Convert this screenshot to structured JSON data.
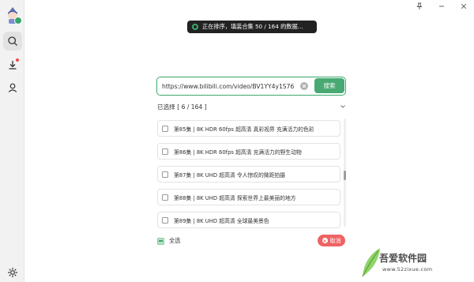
{
  "toast": {
    "text": "正在排序，填装合集 50 / 164 的数据..."
  },
  "search": {
    "url_value": "https://www.bilibili.com/video/BV1YY4y1S76",
    "button_label": "搜索"
  },
  "selection": {
    "header": "已选择 [ 6 / 164 ]"
  },
  "episodes": [
    "第85集 | 8K HDR 60fps 超高清 真彩视界 充满活力的色彩",
    "第86集 | 8K HDR 60fps 超高清 充满活力的野生动物",
    "第87集 | 8K UHD 超高清 令人惊叹的微距拍摄",
    "第88集 | 8K UHD 超高清 探索世界上最美丽的地方",
    "第89集 | 8K UHD 超高清 全球最美景色"
  ],
  "footer": {
    "select_all": "全选",
    "cancel": "取消"
  },
  "watermark": {
    "text": "吾爱软件园",
    "url": "www.52zixue.com"
  },
  "colors": {
    "accent": "#48a973",
    "danger": "#ef6262",
    "toast_bg": "#222222"
  },
  "icons": {
    "sidebar": [
      "search-icon",
      "download-icon",
      "user-icon",
      "settings-icon"
    ],
    "window": [
      "pin-icon",
      "minimize-icon",
      "close-icon"
    ]
  }
}
